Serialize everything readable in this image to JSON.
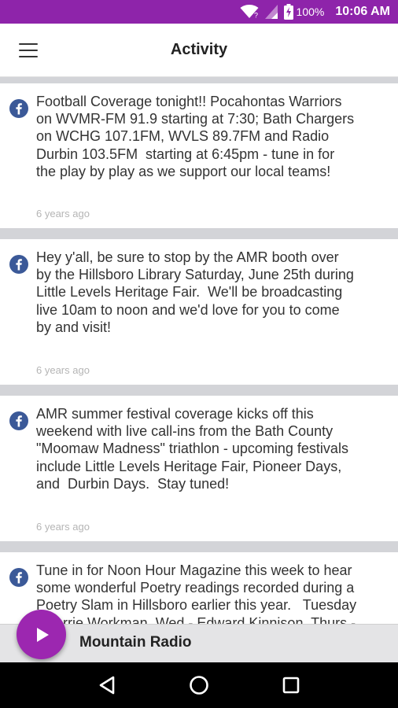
{
  "status_bar": {
    "battery_percent": "100%",
    "time": "10:06 AM",
    "icons": [
      "wifi-icon",
      "signal-icon",
      "battery-charging-icon"
    ],
    "color": "#8e24aa"
  },
  "app_bar": {
    "title": "Activity",
    "menu_icon": "hamburger-menu-icon"
  },
  "feed": {
    "items": [
      {
        "source_icon": "facebook-icon",
        "text": "Football Coverage tonight!! Pocahontas Warriors\non WVMR-FM 91.9 starting at 7:30; Bath Chargers\non WCHG 107.1FM, WVLS 89.7FM and Radio\nDurbin 103.5FM  starting at 6:45pm - tune in for\nthe play by play as we support our local teams!",
        "time": "6 years ago"
      },
      {
        "source_icon": "facebook-icon",
        "text": "Hey y'all, be sure to stop by the AMR booth over\nby the Hillsboro Library Saturday, June 25th during\nLittle Levels Heritage Fair.  We'll be broadcasting\nlive 10am to noon and we'd love for you to come\nby and visit!",
        "time": "6 years ago"
      },
      {
        "source_icon": "facebook-icon",
        "text": "AMR summer festival coverage kicks off this\nweekend with live call-ins from the Bath County\n\"Moomaw Madness\" triathlon - upcoming festivals\ninclude Little Levels Heritage Fair, Pioneer Days,\nand  Durbin Days.  Stay tuned!",
        "time": "6 years ago"
      },
      {
        "source_icon": "facebook-icon",
        "text": "Tune in for Noon Hour Magazine this week to hear\nsome wonderful Poetry readings recorded during a\nPoetry Slam in Hillsboro earlier this year.   Tuesday\n- Carrie Workman, Wed - Edward Kinnison, Thurs -",
        "time": ""
      }
    ]
  },
  "player": {
    "station_name": "Mountain Radio",
    "play_icon": "play-icon",
    "accent_color": "#9c27b0"
  },
  "nav_bar": {
    "buttons": [
      "back-icon",
      "home-icon",
      "recents-icon"
    ]
  }
}
